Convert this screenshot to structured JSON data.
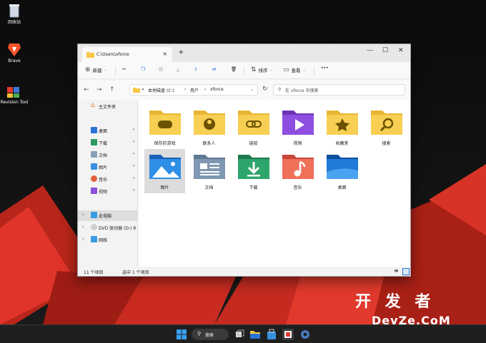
{
  "desktop": {
    "icons": [
      {
        "label": "回收站"
      },
      {
        "label": "Brave"
      },
      {
        "label": "Revision Tool"
      }
    ]
  },
  "window": {
    "tab_title": "C:\\Users\\xforce",
    "tab_close": "×",
    "new_tab": "+",
    "controls": {
      "minimize": "—",
      "maximize": "☐",
      "close": "✕"
    },
    "toolbar": {
      "new_label": "新建",
      "sort_label": "排序",
      "view_label": "查看",
      "more": "···"
    },
    "address": {
      "back": "←",
      "forward": "→",
      "up": "↑",
      "segments": [
        "«",
        "本地磁盘 (C:)",
        "›",
        "用户",
        "›",
        "xforce"
      ],
      "refresh": "↻",
      "search_placeholder": "在 xforce 中搜索"
    },
    "sidebar": {
      "home": "主文件夹",
      "quick": [
        "桌面",
        "下载",
        "文档",
        "图片",
        "音乐",
        "视频"
      ],
      "this_pc": "此电脑",
      "dvd": "DVD 驱动器 (D:) R",
      "network": "网络"
    },
    "items": [
      {
        "label": "保存的游戏"
      },
      {
        "label": "联系人"
      },
      {
        "label": "链接"
      },
      {
        "label": "视频"
      },
      {
        "label": "收藏夹"
      },
      {
        "label": "搜索"
      },
      {
        "label": "图片"
      },
      {
        "label": "文档"
      },
      {
        "label": "下载"
      },
      {
        "label": "音乐"
      },
      {
        "label": "桌面"
      }
    ],
    "status": {
      "count": "11 个项目",
      "selected": "选中 1 个项目"
    }
  },
  "taskbar": {
    "search_label": "搜索"
  },
  "watermark": {
    "line1": "开 发 者",
    "line2": "DevZe.CoM"
  },
  "colors": {
    "folder_yellow": "#f7cf52",
    "accent_blue": "#2b74d6",
    "wallpaper_red": "#d42a1c"
  }
}
